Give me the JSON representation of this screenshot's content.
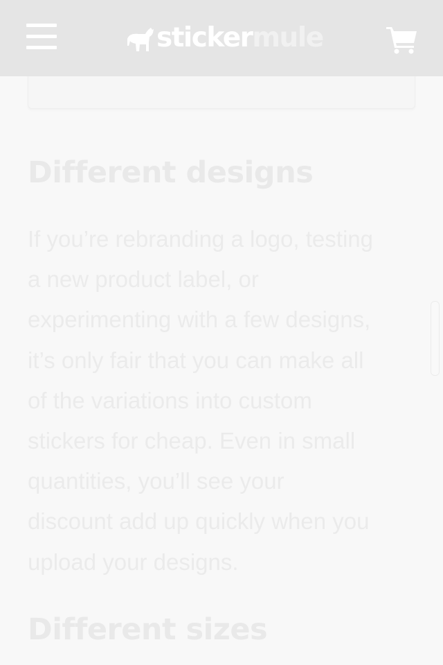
{
  "header": {
    "menu_label": "Menu",
    "logo": {
      "part1": "sticker",
      "part2": "mule",
      "icon": "mule-icon"
    },
    "cart_icon": "cart-icon"
  },
  "content": {
    "section1": {
      "heading": "Different designs",
      "paragraph_lines": [
        "If you’re rebranding a logo, testing",
        "a new product label, or",
        "experimenting with a few designs,",
        "it’s only fair that you can make all",
        "of the variations into custom",
        "stickers for cheap. Even in small",
        "quantities, you’ll see your",
        "discount add up quickly when you",
        "upload your designs."
      ]
    },
    "section2": {
      "heading": "Different sizes"
    }
  },
  "colors": {
    "header_bg": "#e5e5e5",
    "page_bg": "#f8f8f8",
    "text": "#ebebeb",
    "heading": "#e9e9e9",
    "logo_white": "#ffffff"
  }
}
